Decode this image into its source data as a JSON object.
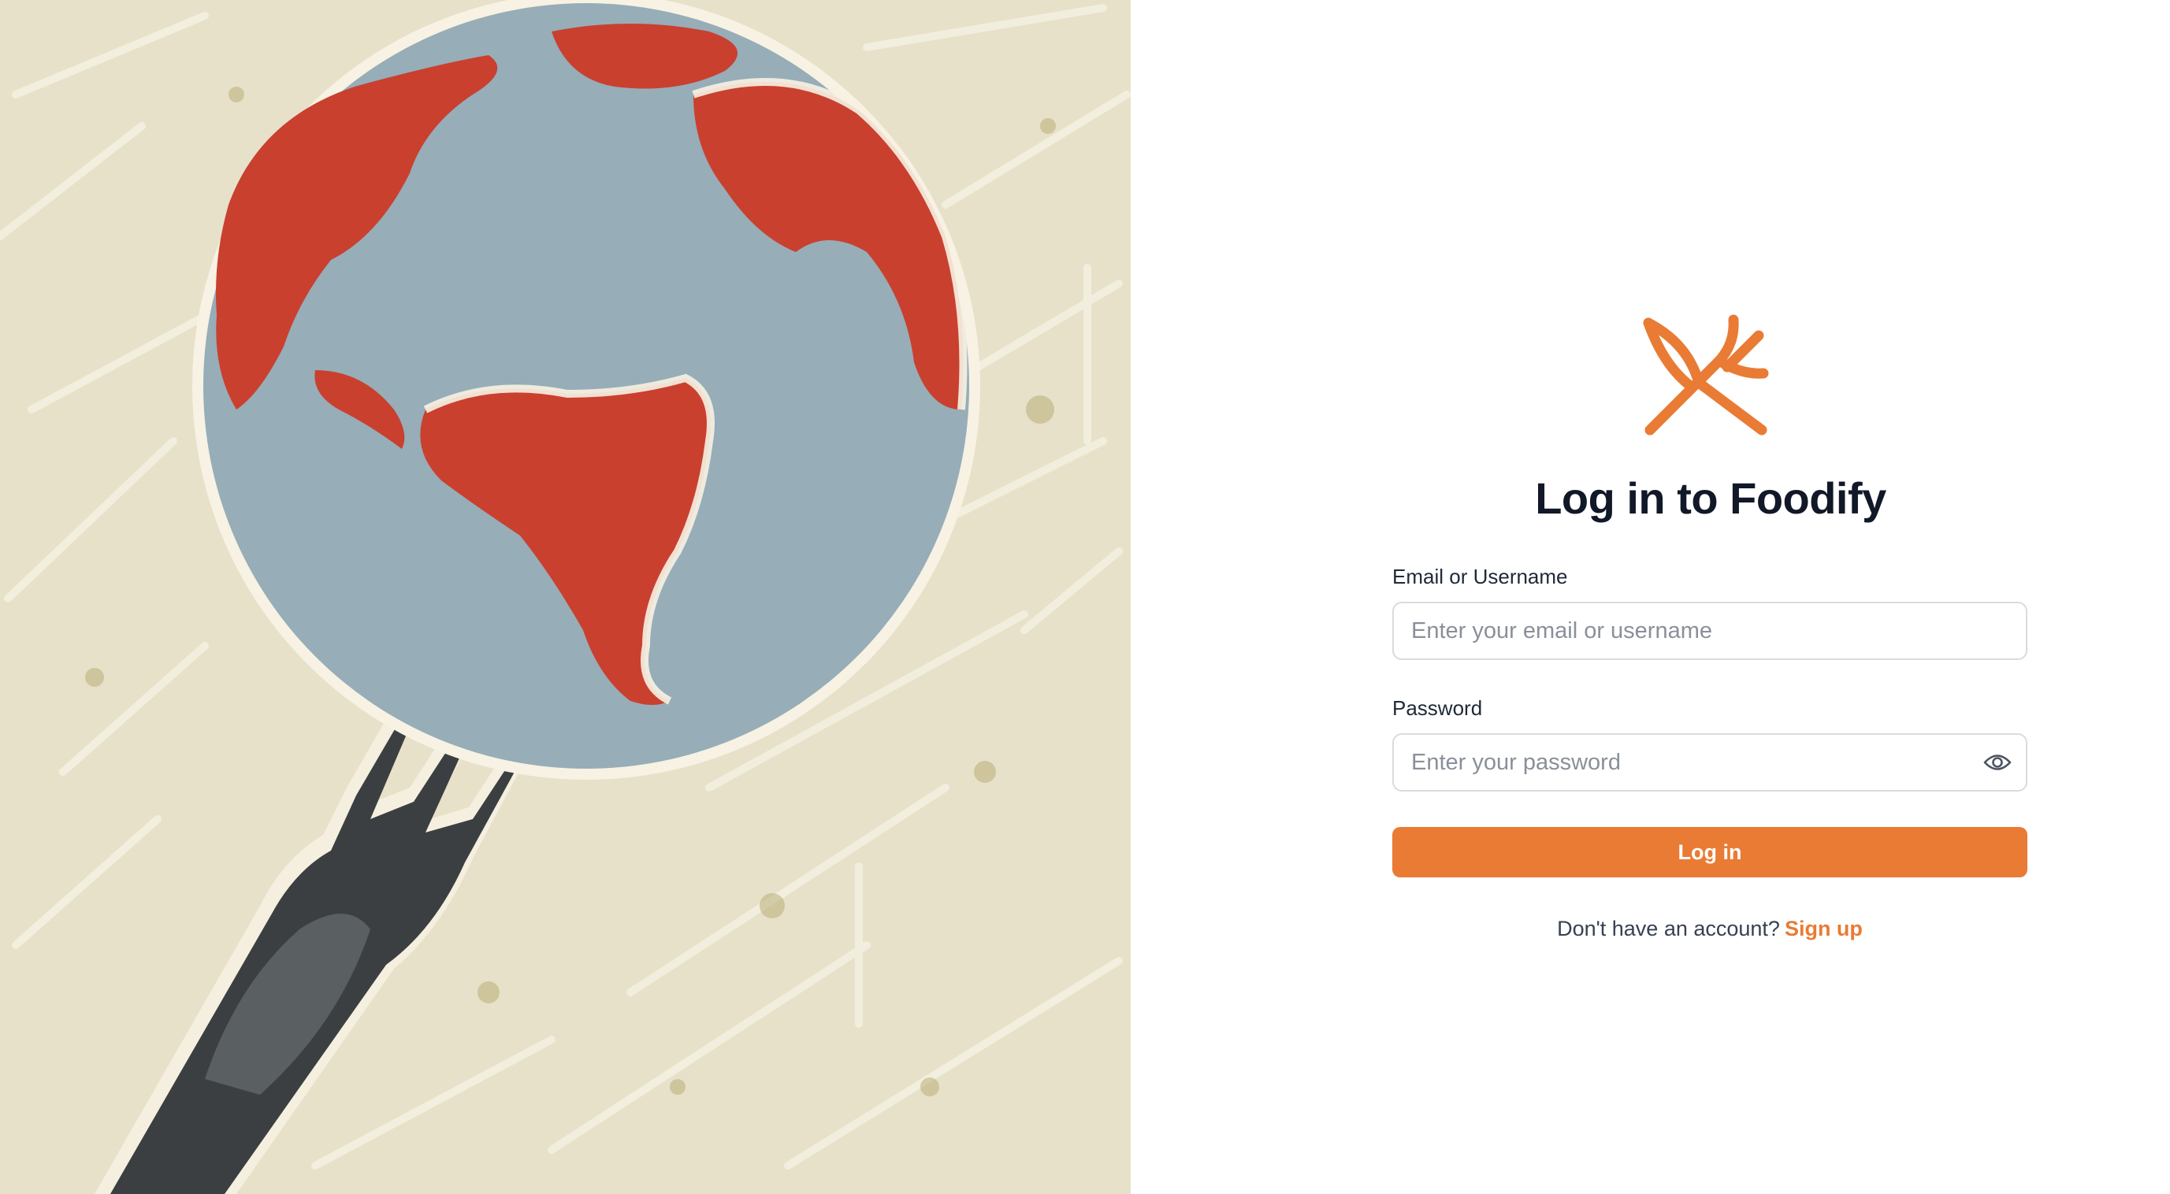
{
  "hero": {
    "illustration": "globe-on-fork-illustration",
    "colors": {
      "background": "#e7e1c9",
      "ocean": "#97adb8",
      "land": "#c9402f",
      "fork": "#3b3f41",
      "outline": "#f7f2e3"
    }
  },
  "brand": {
    "logo_icon": "fork-knife-icon",
    "accent_color": "#e97b35"
  },
  "login": {
    "title": "Log in to Foodify",
    "email_label": "Email or Username",
    "email_placeholder": "Enter your email or username",
    "email_value": "",
    "password_label": "Password",
    "password_placeholder": "Enter your password",
    "password_value": "",
    "password_toggle_icon": "eye-icon",
    "submit_label": "Log in",
    "signup_prompt": "Don't have an account?",
    "signup_link": "Sign up"
  }
}
